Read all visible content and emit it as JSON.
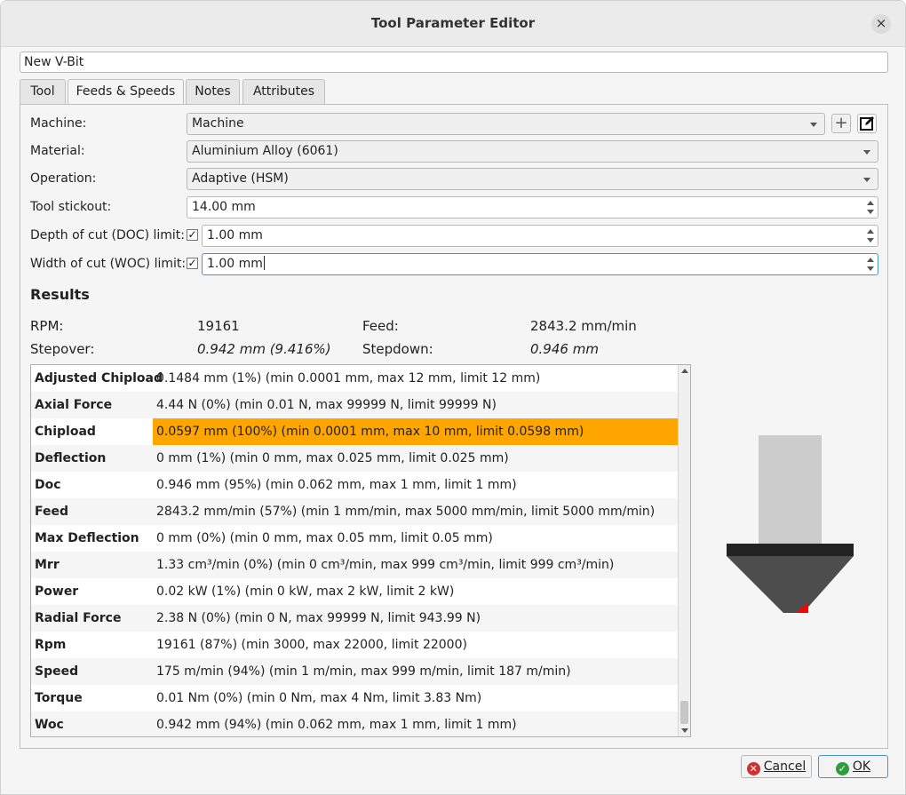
{
  "window": {
    "title": "Tool Parameter Editor"
  },
  "tool_name": "New V-Bit",
  "tabs": [
    {
      "label": "Tool"
    },
    {
      "label": "Feeds & Speeds",
      "active": true
    },
    {
      "label": "Notes"
    },
    {
      "label": "Attributes"
    }
  ],
  "form": {
    "machine": {
      "label": "Machine:",
      "value": "Machine"
    },
    "material": {
      "label": "Material:",
      "value": "Aluminium Alloy (6061)"
    },
    "operation": {
      "label": "Operation:",
      "value": "Adaptive (HSM)"
    },
    "stickout": {
      "label": "Tool stickout:",
      "value": "14.00 mm"
    },
    "doc": {
      "label": "Depth of cut (DOC) limit:",
      "value": "1.00 mm",
      "checked": true,
      "check_glyph": "✓"
    },
    "woc": {
      "label": "Width of cut (WOC) limit:",
      "value": "1.00 mm",
      "checked": true,
      "check_glyph": "✓"
    }
  },
  "results": {
    "title": "Results",
    "rpm_label": "RPM:",
    "rpm_value": "19161",
    "feed_label": "Feed:",
    "feed_value": "2843.2 mm/min",
    "stepover_label": "Stepover:",
    "stepover_value": "0.942 mm (9.416%)",
    "stepdown_label": "Stepdown:",
    "stepdown_value": "0.946 mm"
  },
  "table_rows": [
    {
      "name": "Adjusted Chipload",
      "value": "0.1484 mm (1%) (min 0.0001 mm, max 12 mm, limit 12 mm)"
    },
    {
      "name": "Axial Force",
      "value": "4.44 N (0%) (min 0.01 N, max 99999 N, limit 99999 N)"
    },
    {
      "name": "Chipload",
      "value": "0.0597 mm (100%) (min 0.0001 mm, max 10 mm, limit 0.0598 mm)",
      "highlight": true
    },
    {
      "name": "Deflection",
      "value": "0 mm (1%) (min 0 mm, max 0.025 mm, limit 0.025 mm)"
    },
    {
      "name": "Doc",
      "value": "0.946 mm (95%) (min 0.062 mm, max 1 mm, limit 1 mm)"
    },
    {
      "name": "Feed",
      "value": "2843.2 mm/min (57%) (min 1 mm/min, max 5000 mm/min, limit 5000 mm/min)"
    },
    {
      "name": "Max Deflection",
      "value": "0 mm (0%) (min 0 mm, max 0.05 mm, limit 0.05 mm)"
    },
    {
      "name": "Mrr",
      "value": "1.33 cm³/min (0%) (min 0 cm³/min, max 999 cm³/min, limit 999 cm³/min)"
    },
    {
      "name": "Power",
      "value": "0.02 kW (1%) (min 0 kW, max 2 kW, limit 2 kW)"
    },
    {
      "name": "Radial Force",
      "value": "2.38 N (0%) (min 0 N, max 99999 N, limit 943.99 N)"
    },
    {
      "name": "Rpm",
      "value": "19161 (87%) (min 3000, max 22000, limit 22000)"
    },
    {
      "name": "Speed",
      "value": "175 m/min (94%) (min 1 m/min, max 999 m/min, limit 187 m/min)"
    },
    {
      "name": "Torque",
      "value": "0.01 Nm (0%) (min 0 Nm, max 4 Nm, limit 3.83 Nm)"
    },
    {
      "name": "Woc",
      "value": "0.942 mm (94%) (min 0.062 mm, max 1 mm, limit 1 mm)"
    }
  ],
  "buttons": {
    "cancel_label": "Cancel",
    "ok_label": "OK",
    "cancel_icon_glyph": "✕",
    "ok_icon_glyph": "✓"
  },
  "icons": {
    "add_glyph": "+",
    "close_glyph": "×"
  },
  "colors": {
    "highlight": "#ffa500",
    "tool_shank": "#cccccc",
    "tool_collar": "#222222",
    "tool_cone": "#4d4d4d",
    "tool_tip_marker": "#ff0000"
  }
}
